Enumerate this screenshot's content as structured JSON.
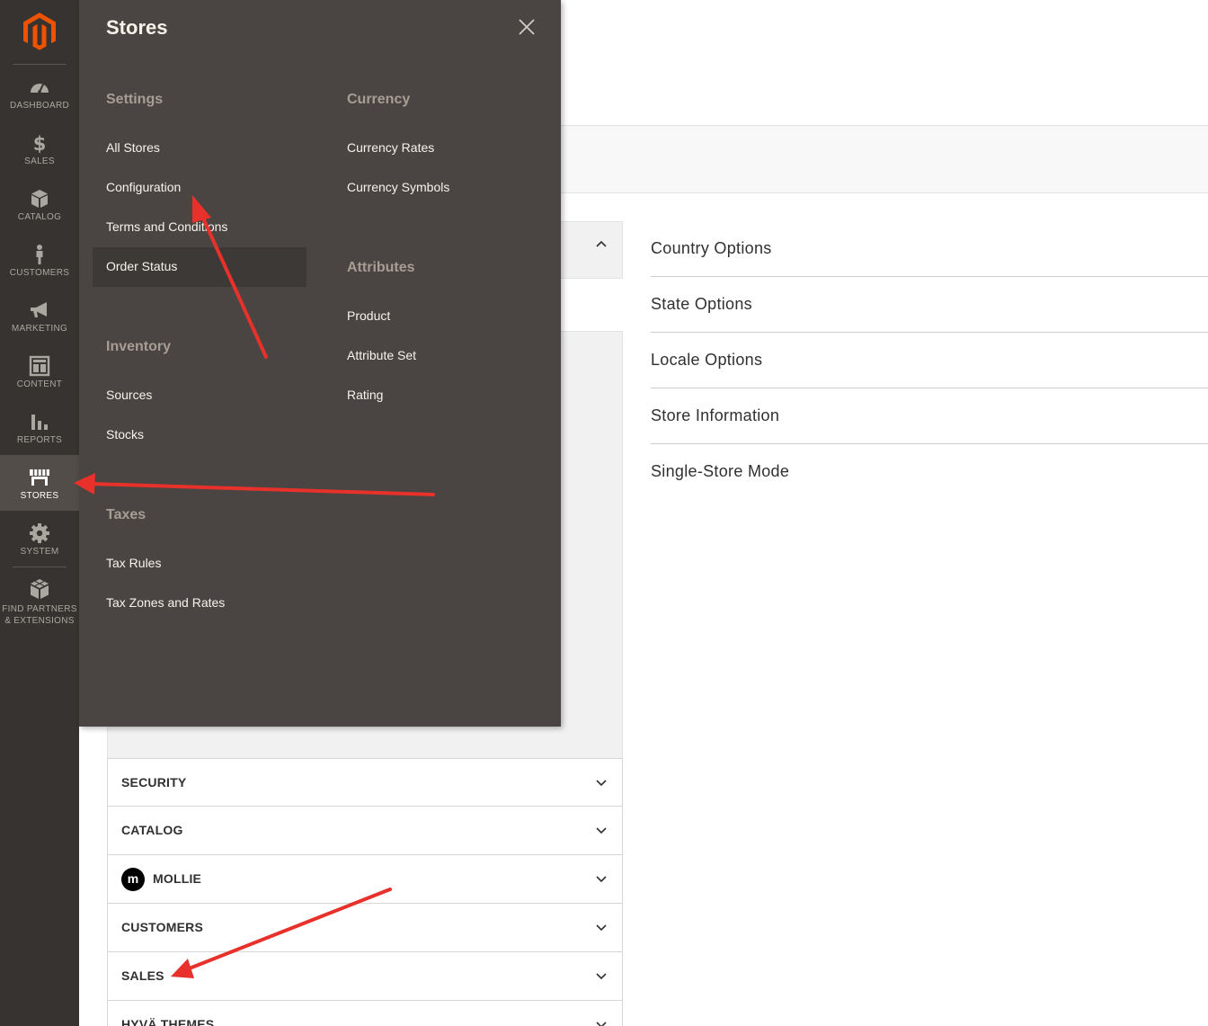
{
  "sidebar": {
    "items": [
      {
        "label": "DASHBOARD",
        "icon": "dashboard-icon"
      },
      {
        "label": "SALES",
        "icon": "dollar-icon"
      },
      {
        "label": "CATALOG",
        "icon": "box-icon"
      },
      {
        "label": "CUSTOMERS",
        "icon": "person-icon"
      },
      {
        "label": "MARKETING",
        "icon": "megaphone-icon"
      },
      {
        "label": "CONTENT",
        "icon": "layout-icon"
      },
      {
        "label": "REPORTS",
        "icon": "bar-chart-icon"
      },
      {
        "label": "STORES",
        "icon": "storefront-icon"
      },
      {
        "label": "SYSTEM",
        "icon": "gear-icon"
      },
      {
        "label_line1": "FIND PARTNERS",
        "label_line2": "& EXTENSIONS",
        "icon": "cubes-icon"
      }
    ],
    "active": "STORES"
  },
  "flyout": {
    "title": "Stores",
    "sections": {
      "settings": {
        "title": "Settings",
        "items": [
          "All Stores",
          "Configuration",
          "Terms and Conditions",
          "Order Status"
        ]
      },
      "inventory": {
        "title": "Inventory",
        "items": [
          "Sources",
          "Stocks"
        ]
      },
      "taxes": {
        "title": "Taxes",
        "items": [
          "Tax Rules",
          "Tax Zones and Rates"
        ]
      },
      "currency": {
        "title": "Currency",
        "items": [
          "Currency Rates",
          "Currency Symbols"
        ]
      },
      "attributes": {
        "title": "Attributes",
        "items": [
          "Product",
          "Attribute Set",
          "Rating"
        ]
      }
    },
    "highlighted_item": "Order Status"
  },
  "config_tabs": {
    "items": [
      {
        "label": "SECURITY"
      },
      {
        "label": "CATALOG"
      },
      {
        "label": "MOLLIE",
        "logo": "m"
      },
      {
        "label": "CUSTOMERS"
      },
      {
        "label": "SALES"
      },
      {
        "label": "HYVÄ THEMES"
      }
    ]
  },
  "config_sections": [
    "Country Options",
    "State Options",
    "Locale Options",
    "Store Information",
    "Single-Store Mode"
  ],
  "colors": {
    "sidebar_bg": "#373330",
    "flyout_bg": "#4a4542",
    "brand_orange": "#eb5202",
    "annotation_red": "#e8312a"
  }
}
